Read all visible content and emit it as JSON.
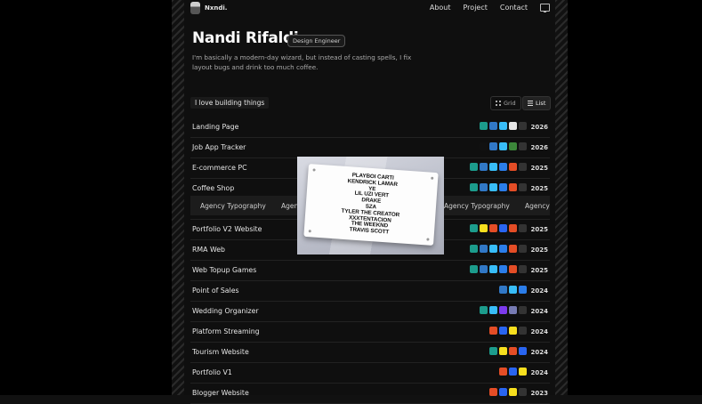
{
  "nav": {
    "brand": "Nxndi.",
    "links": [
      "About",
      "Project",
      "Contact"
    ]
  },
  "profile": {
    "name": "Nandi Rifaldi",
    "role": "Design Engineer",
    "bio": "I'm basically a modern-day wizard, but instead of casting spells, I fix layout bugs and drink too much coffee."
  },
  "section": {
    "title": "I love building things",
    "view_grid": "Grid",
    "view_list": "List"
  },
  "projects": [
    {
      "title": "Landing Page",
      "year": "2026",
      "stack": [
        "#1c9c8c",
        "#3178c6",
        "#38bdf8",
        "#e5e5e5",
        "#333333"
      ]
    },
    {
      "title": "Job App Tracker",
      "year": "2026",
      "stack": [
        "#111111",
        "#3178c6",
        "#38bdf8",
        "#3c873a",
        "#333333"
      ]
    },
    {
      "title": "E-commerce PC",
      "year": "2025",
      "stack": [
        "#1c9c8c",
        "#3178c6",
        "#38bdf8",
        "#2b7de9",
        "#e44d26",
        "#333333"
      ]
    },
    {
      "title": "Coffee Shop",
      "year": "2025",
      "stack": [
        "#1c9c8c",
        "#3178c6",
        "#38bdf8",
        "#2b7de9",
        "#e44d26",
        "#333333"
      ]
    },
    {
      "title": "Portfolio V2 Website",
      "year": "2025",
      "stack": [
        "#1c9c8c",
        "#f7df1e",
        "#e44d26",
        "#2965f1",
        "#e44d26",
        "#333333"
      ]
    },
    {
      "title": "RMA Web",
      "year": "2025",
      "stack": [
        "#1c9c8c",
        "#3178c6",
        "#38bdf8",
        "#2b7de9",
        "#e44d26",
        "#333333"
      ]
    },
    {
      "title": "Web Topup Games",
      "year": "2025",
      "stack": [
        "#1c9c8c",
        "#3178c6",
        "#38bdf8",
        "#2b7de9",
        "#e44d26",
        "#333333"
      ]
    },
    {
      "title": "Point of Sales",
      "year": "2024",
      "stack": [
        "#3178c6",
        "#38bdf8",
        "#2b7de9"
      ]
    },
    {
      "title": "Wedding Organizer",
      "year": "2024",
      "stack": [
        "#1c9c8c",
        "#38bdf8",
        "#7c3aed",
        "#777bb3",
        "#333333"
      ]
    },
    {
      "title": "Platform Streaming",
      "year": "2024",
      "stack": [
        "#e44d26",
        "#2965f1",
        "#f7df1e",
        "#333333"
      ]
    },
    {
      "title": "Tourism Website",
      "year": "2024",
      "stack": [
        "#1c9c8c",
        "#f7df1e",
        "#e44d26",
        "#2965f1"
      ]
    },
    {
      "title": "Portfolio V1",
      "year": "2024",
      "stack": [
        "#e44d26",
        "#2965f1",
        "#f7df1e"
      ]
    },
    {
      "title": "Blogger Website",
      "year": "2023",
      "stack": [
        "#e44d26",
        "#2965f1",
        "#f7df1e",
        "#333333"
      ]
    }
  ],
  "marquee": {
    "items": [
      "Agency Typography",
      "Agency Typography",
      "Agency Typography",
      "Agency Typography"
    ]
  },
  "poster": {
    "lines": [
      "PLAYBOI CARTI",
      "KENDRICK LAMAR",
      "YE",
      "LIL UZI VERT",
      "DRAKE",
      "SZA",
      "TYLER THE CREATOR",
      "XXXTENTACION",
      "THE WEEKND",
      "TRAVIS SCOTT"
    ]
  }
}
